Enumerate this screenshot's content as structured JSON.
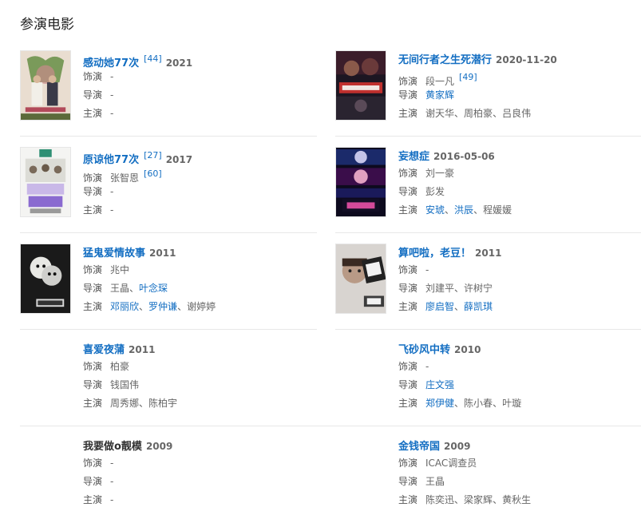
{
  "section_title": "参演电影",
  "labels": {
    "role": "饰演",
    "director": "导演",
    "cast": "主演",
    "sep": "、"
  },
  "colors": {
    "link": "#136ec2",
    "divider": "#e8e8e8"
  },
  "films": [
    {
      "title": "感动她77次",
      "title_ref": "[44]",
      "year": "2021",
      "role": "-",
      "role_ref": "",
      "director": [
        "-"
      ],
      "director_links": [
        false
      ],
      "cast": [
        "-"
      ],
      "cast_links": [
        false
      ]
    },
    {
      "title": "无间行者之生死潜行",
      "title_ref": "",
      "year": "2020-11-20",
      "role": "段一凡",
      "role_ref": "[49]",
      "director": [
        "黄家辉"
      ],
      "director_links": [
        true
      ],
      "cast": [
        "谢天华",
        "周柏豪",
        "吕良伟"
      ],
      "cast_links": [
        false,
        false,
        false
      ]
    },
    {
      "title": "原谅他77次",
      "title_ref": "[27]",
      "year": "2017",
      "role": "张智恩",
      "role_ref": "[60]",
      "director": [
        "-"
      ],
      "director_links": [
        false
      ],
      "cast": [
        "-"
      ],
      "cast_links": [
        false
      ]
    },
    {
      "title": "妄想症",
      "title_ref": "",
      "year": "2016-05-06",
      "role": "刘一豪",
      "role_ref": "",
      "director": [
        "彭发"
      ],
      "director_links": [
        false
      ],
      "cast": [
        "安琥",
        "洪辰",
        "程媛媛"
      ],
      "cast_links": [
        true,
        true,
        false
      ]
    },
    {
      "title": "猛鬼爱情故事",
      "title_ref": "",
      "year": "2011",
      "role": "兆中",
      "role_ref": "",
      "director": [
        "王晶",
        "叶念琛"
      ],
      "director_links": [
        false,
        true
      ],
      "cast": [
        "邓丽欣",
        "罗仲谦",
        "谢婷婷"
      ],
      "cast_links": [
        true,
        true,
        false
      ]
    },
    {
      "title": "算吧啦，老豆！",
      "title_ref": "",
      "year": "2011",
      "role": "-",
      "role_ref": "",
      "director": [
        "刘建平",
        "许树宁"
      ],
      "director_links": [
        false,
        false
      ],
      "cast": [
        "廖启智",
        "薛凯琪"
      ],
      "cast_links": [
        true,
        true
      ]
    },
    {
      "title": "喜爱夜蒲",
      "title_ref": "",
      "year": "2011",
      "role": "柏豪",
      "role_ref": "",
      "director": [
        "钱国伟"
      ],
      "director_links": [
        false
      ],
      "cast": [
        "周秀娜",
        "陈柏宇"
      ],
      "cast_links": [
        false,
        false
      ]
    },
    {
      "title": "飞砂风中转",
      "title_ref": "",
      "year": "2010",
      "role": "-",
      "role_ref": "",
      "director": [
        "庄文强"
      ],
      "director_links": [
        true
      ],
      "cast": [
        "郑伊健",
        "陈小春",
        "叶璇"
      ],
      "cast_links": [
        true,
        false,
        false
      ]
    },
    {
      "title": "我要做o靓模",
      "title_ref": "",
      "year": "2009",
      "role": "-",
      "role_ref": "",
      "director": [
        "-"
      ],
      "director_links": [
        false
      ],
      "cast": [
        "-"
      ],
      "cast_links": [
        false
      ]
    },
    {
      "title": "金钱帝国",
      "title_ref": "",
      "year": "2009",
      "role": "ICAC调查员",
      "role_ref": "",
      "director": [
        "王晶"
      ],
      "director_links": [
        false
      ],
      "cast": [
        "陈奕迅",
        "梁家辉",
        "黄秋生"
      ],
      "cast_links": [
        false,
        false,
        false
      ]
    }
  ]
}
